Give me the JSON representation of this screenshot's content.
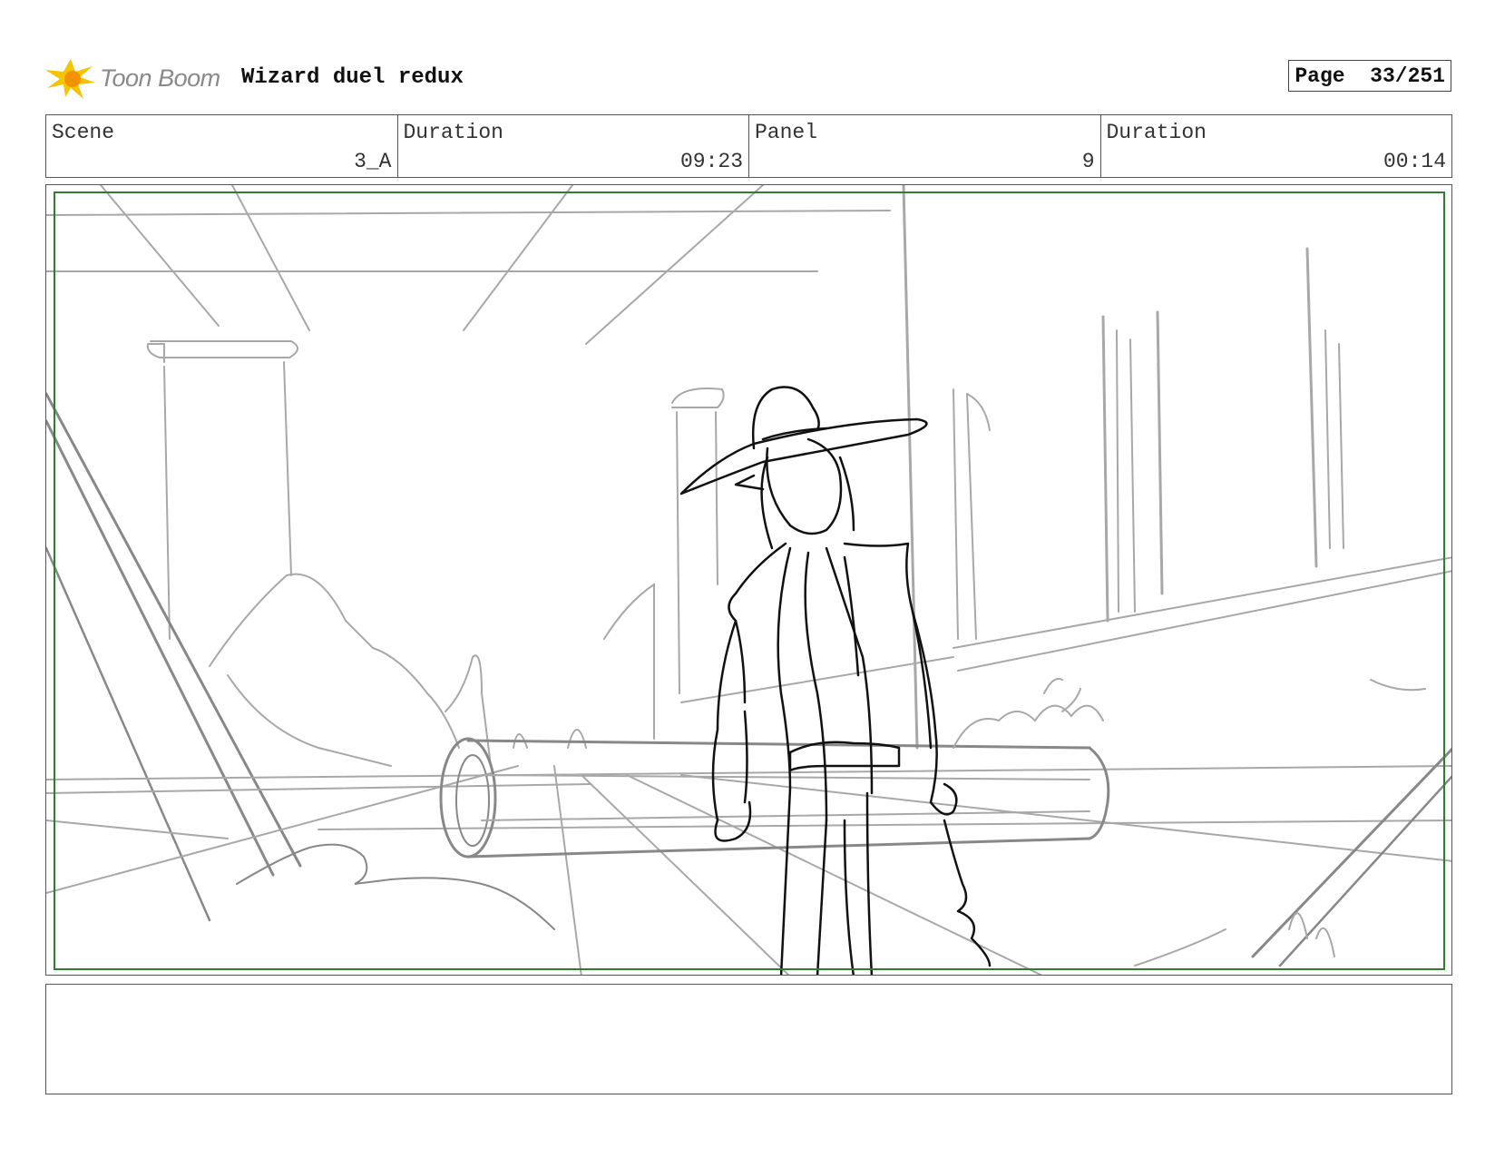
{
  "header": {
    "logo_text": "Toon Boom",
    "project_title": "Wizard duel redux",
    "page_label": "Page",
    "page_value": "33/251"
  },
  "info": [
    {
      "label": "Scene",
      "value": "3_A"
    },
    {
      "label": "Duration",
      "value": "09:23"
    },
    {
      "label": "Panel",
      "value": "9"
    },
    {
      "label": "Duration",
      "value": "00:14"
    }
  ],
  "panel": {
    "safe_frame_color": "#2e7d32",
    "background_sketch_color": "#9e9e9e",
    "character_sketch_color": "#111111"
  },
  "notes": {
    "text": ""
  },
  "colors": {
    "logo_yellow": "#f5c400",
    "logo_orange": "#f39200",
    "border": "#555555"
  }
}
